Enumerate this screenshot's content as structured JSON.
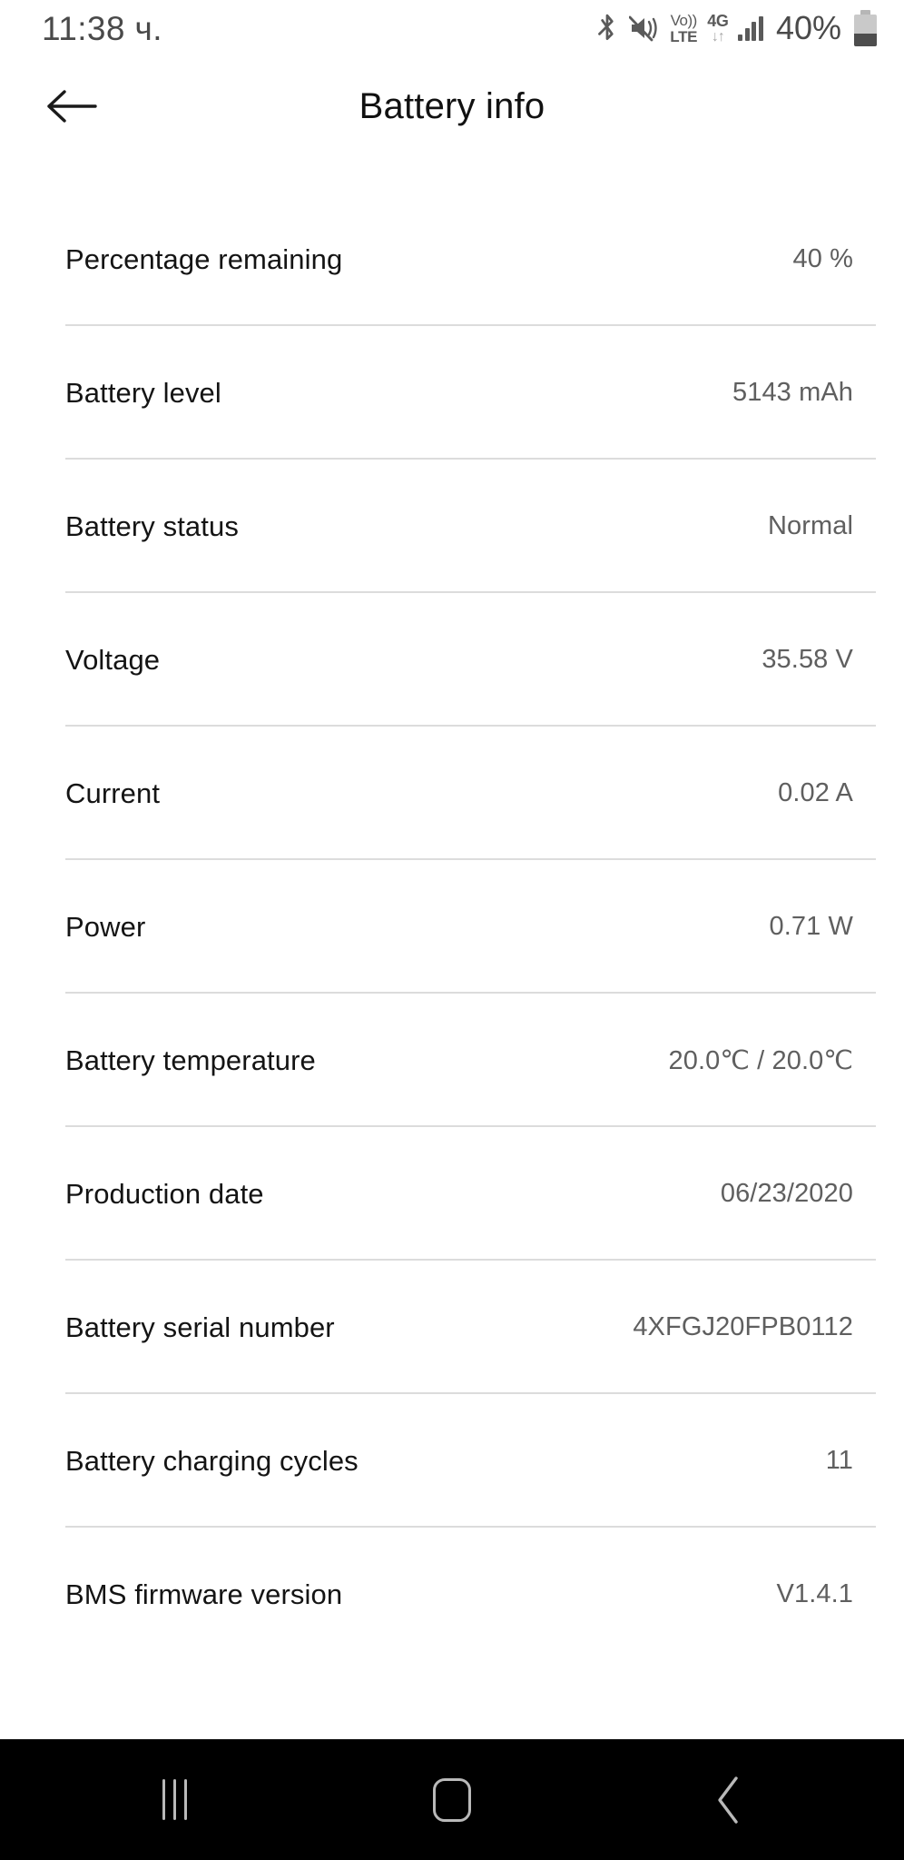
{
  "statusbar": {
    "time": "11:38 ч.",
    "battery_percent": "40%",
    "icons": {
      "bluetooth": "bluetooth-icon",
      "mute": "sound-mute-icon",
      "volte": "volte-icon",
      "volte_line1": "Vo))",
      "volte_line2": "LTE",
      "network": "4g-icon",
      "network_label": "4G",
      "network_arrows": "↓↑",
      "signal": "signal-bars-icon",
      "battery": "battery-icon"
    }
  },
  "appbar": {
    "title": "Battery info",
    "back_icon": "arrow-left-icon"
  },
  "list": {
    "rows": [
      {
        "label": "Percentage remaining",
        "value": "40 %"
      },
      {
        "label": "Battery level",
        "value": "5143 mAh"
      },
      {
        "label": "Battery status",
        "value": "Normal"
      },
      {
        "label": "Voltage",
        "value": "35.58 V"
      },
      {
        "label": "Current",
        "value": "0.02 A"
      },
      {
        "label": "Power",
        "value": "0.71 W"
      },
      {
        "label": "Battery temperature",
        "value": "20.0℃ / 20.0℃"
      },
      {
        "label": "Production date",
        "value": "06/23/2020"
      },
      {
        "label": "Battery serial number",
        "value": "4XFGJ20FPB0112"
      },
      {
        "label": "Battery charging cycles",
        "value": "11"
      },
      {
        "label": "BMS firmware version",
        "value": "V1.4.1"
      }
    ]
  },
  "navbar": {
    "recents_label": "recents-icon",
    "home_label": "home-icon",
    "back_label": "back-icon"
  },
  "colors": {
    "background": "#ffffff",
    "label_text": "#141414",
    "value_text": "#5f5f5f",
    "divider": "#dcdcdc",
    "navbar_background": "#000000",
    "navbar_icon": "#b9b9b9",
    "status_icon": "#5a5a5a"
  }
}
